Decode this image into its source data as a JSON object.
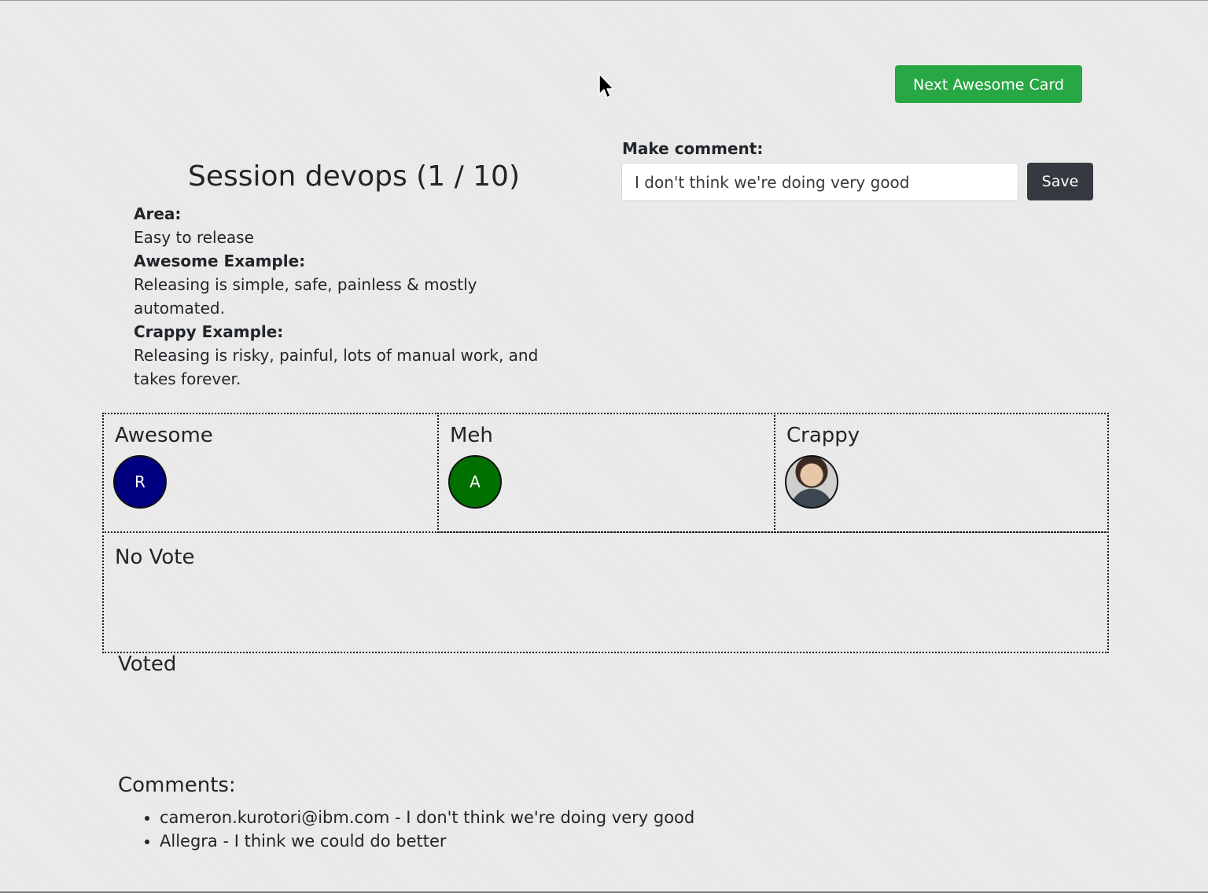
{
  "toolbar": {
    "next_label": "Next Awesome Card"
  },
  "comment_form": {
    "label": "Make comment:",
    "value": "I don't think we're doing very good",
    "save_label": "Save"
  },
  "session": {
    "title": "Session devops (1 / 10)",
    "area_label": "Area:",
    "area_value": "Easy to release",
    "awesome_label": "Awesome Example:",
    "awesome_value": "Releasing is simple, safe, painless & mostly automated.",
    "crappy_label": "Crappy Example:",
    "crappy_value": "Releasing is risky, painful, lots of manual work, and takes forever."
  },
  "votes": {
    "awesome": {
      "title": "Awesome",
      "avatars": [
        {
          "initial": "R",
          "color": "#000080"
        }
      ]
    },
    "meh": {
      "title": "Meh",
      "avatars": [
        {
          "initial": "A",
          "color": "#007000"
        }
      ]
    },
    "crappy": {
      "title": "Crappy",
      "avatars": [
        {
          "initial": "",
          "color": "#cfcfcf"
        }
      ]
    },
    "no_vote": {
      "title": "No Vote"
    }
  },
  "voted": {
    "title": "Voted"
  },
  "comments": {
    "title": "Comments:",
    "items": [
      "cameron.kurotori@ibm.com - I don't think we're doing very good",
      "Allegra - I think we could do better"
    ]
  },
  "colors": {
    "primary_action": "#28a745",
    "dark_action": "#343a40"
  },
  "icons": {
    "cursor": "mouse-pointer-icon"
  }
}
